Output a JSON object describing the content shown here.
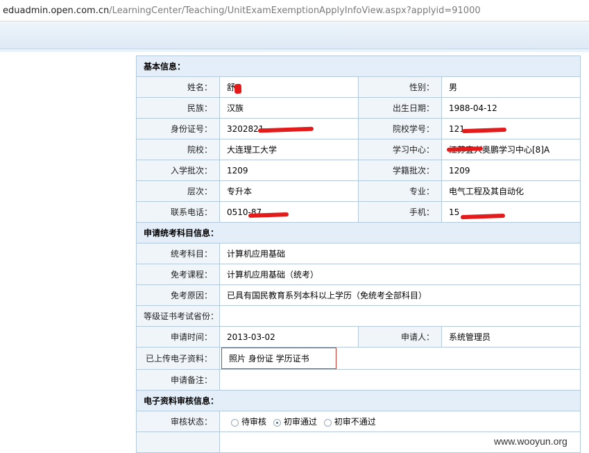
{
  "address": {
    "host": "eduadmin.open.com.cn",
    "path": "/LearningCenter/Teaching/UnitExamExemptionApplyInfoView.aspx?applyid=91000"
  },
  "basic": {
    "section": "基本信息：",
    "name_label": "姓名：",
    "name_value": "舒",
    "gender_label": "性别：",
    "gender_value": "男",
    "ethnic_label": "民族：",
    "ethnic_value": "汉族",
    "birth_label": "出生日期：",
    "birth_value": "1988-04-12",
    "id_label": "身份证号：",
    "id_value": "3202821",
    "school_no_label": "院校学号：",
    "school_no_value": "121",
    "school_label": "院校：",
    "school_value": "大连理工大学",
    "center_label": "学习中心：",
    "center_value": "江苏宜兴奥鹏学习中心[8]A",
    "enroll_label": "入学批次：",
    "enroll_value": "1209",
    "status_label": "学籍批次：",
    "status_value": "1209",
    "level_label": "层次：",
    "level_value": "专升本",
    "major_label": "专业：",
    "major_value": "电气工程及其自动化",
    "phone_label": "联系电话：",
    "phone_value": "0510-87",
    "mobile_label": "手机：",
    "mobile_value": "15"
  },
  "apply": {
    "section": "申请统考科目信息：",
    "subject_label": "统考科目：",
    "subject_value": "计算机应用基础",
    "course_label": "免考课程：",
    "course_value": "计算机应用基础（统考）",
    "reason_label": "免考原因：",
    "reason_value": "已具有国民教育系列本科以上学历（免统考全部科目）",
    "province_label": "等级证书考试省份：",
    "province_value": "",
    "time_label": "申请时间：",
    "time_value": "2013-03-02",
    "applicant_label": "申请人：",
    "applicant_value": "系统管理员",
    "files_label": "已上传电子资料：",
    "files_value": "照片 身份证 学历证书",
    "remark_label": "申请备注：",
    "remark_value": ""
  },
  "review": {
    "section": "电子资料审核信息：",
    "state_label": "审核状态：",
    "options": [
      "待审核",
      "初审通过",
      "初审不通过"
    ],
    "selected": "初审通过"
  },
  "watermark": "www.wooyun.org",
  "mask_color": "#e31b1b"
}
